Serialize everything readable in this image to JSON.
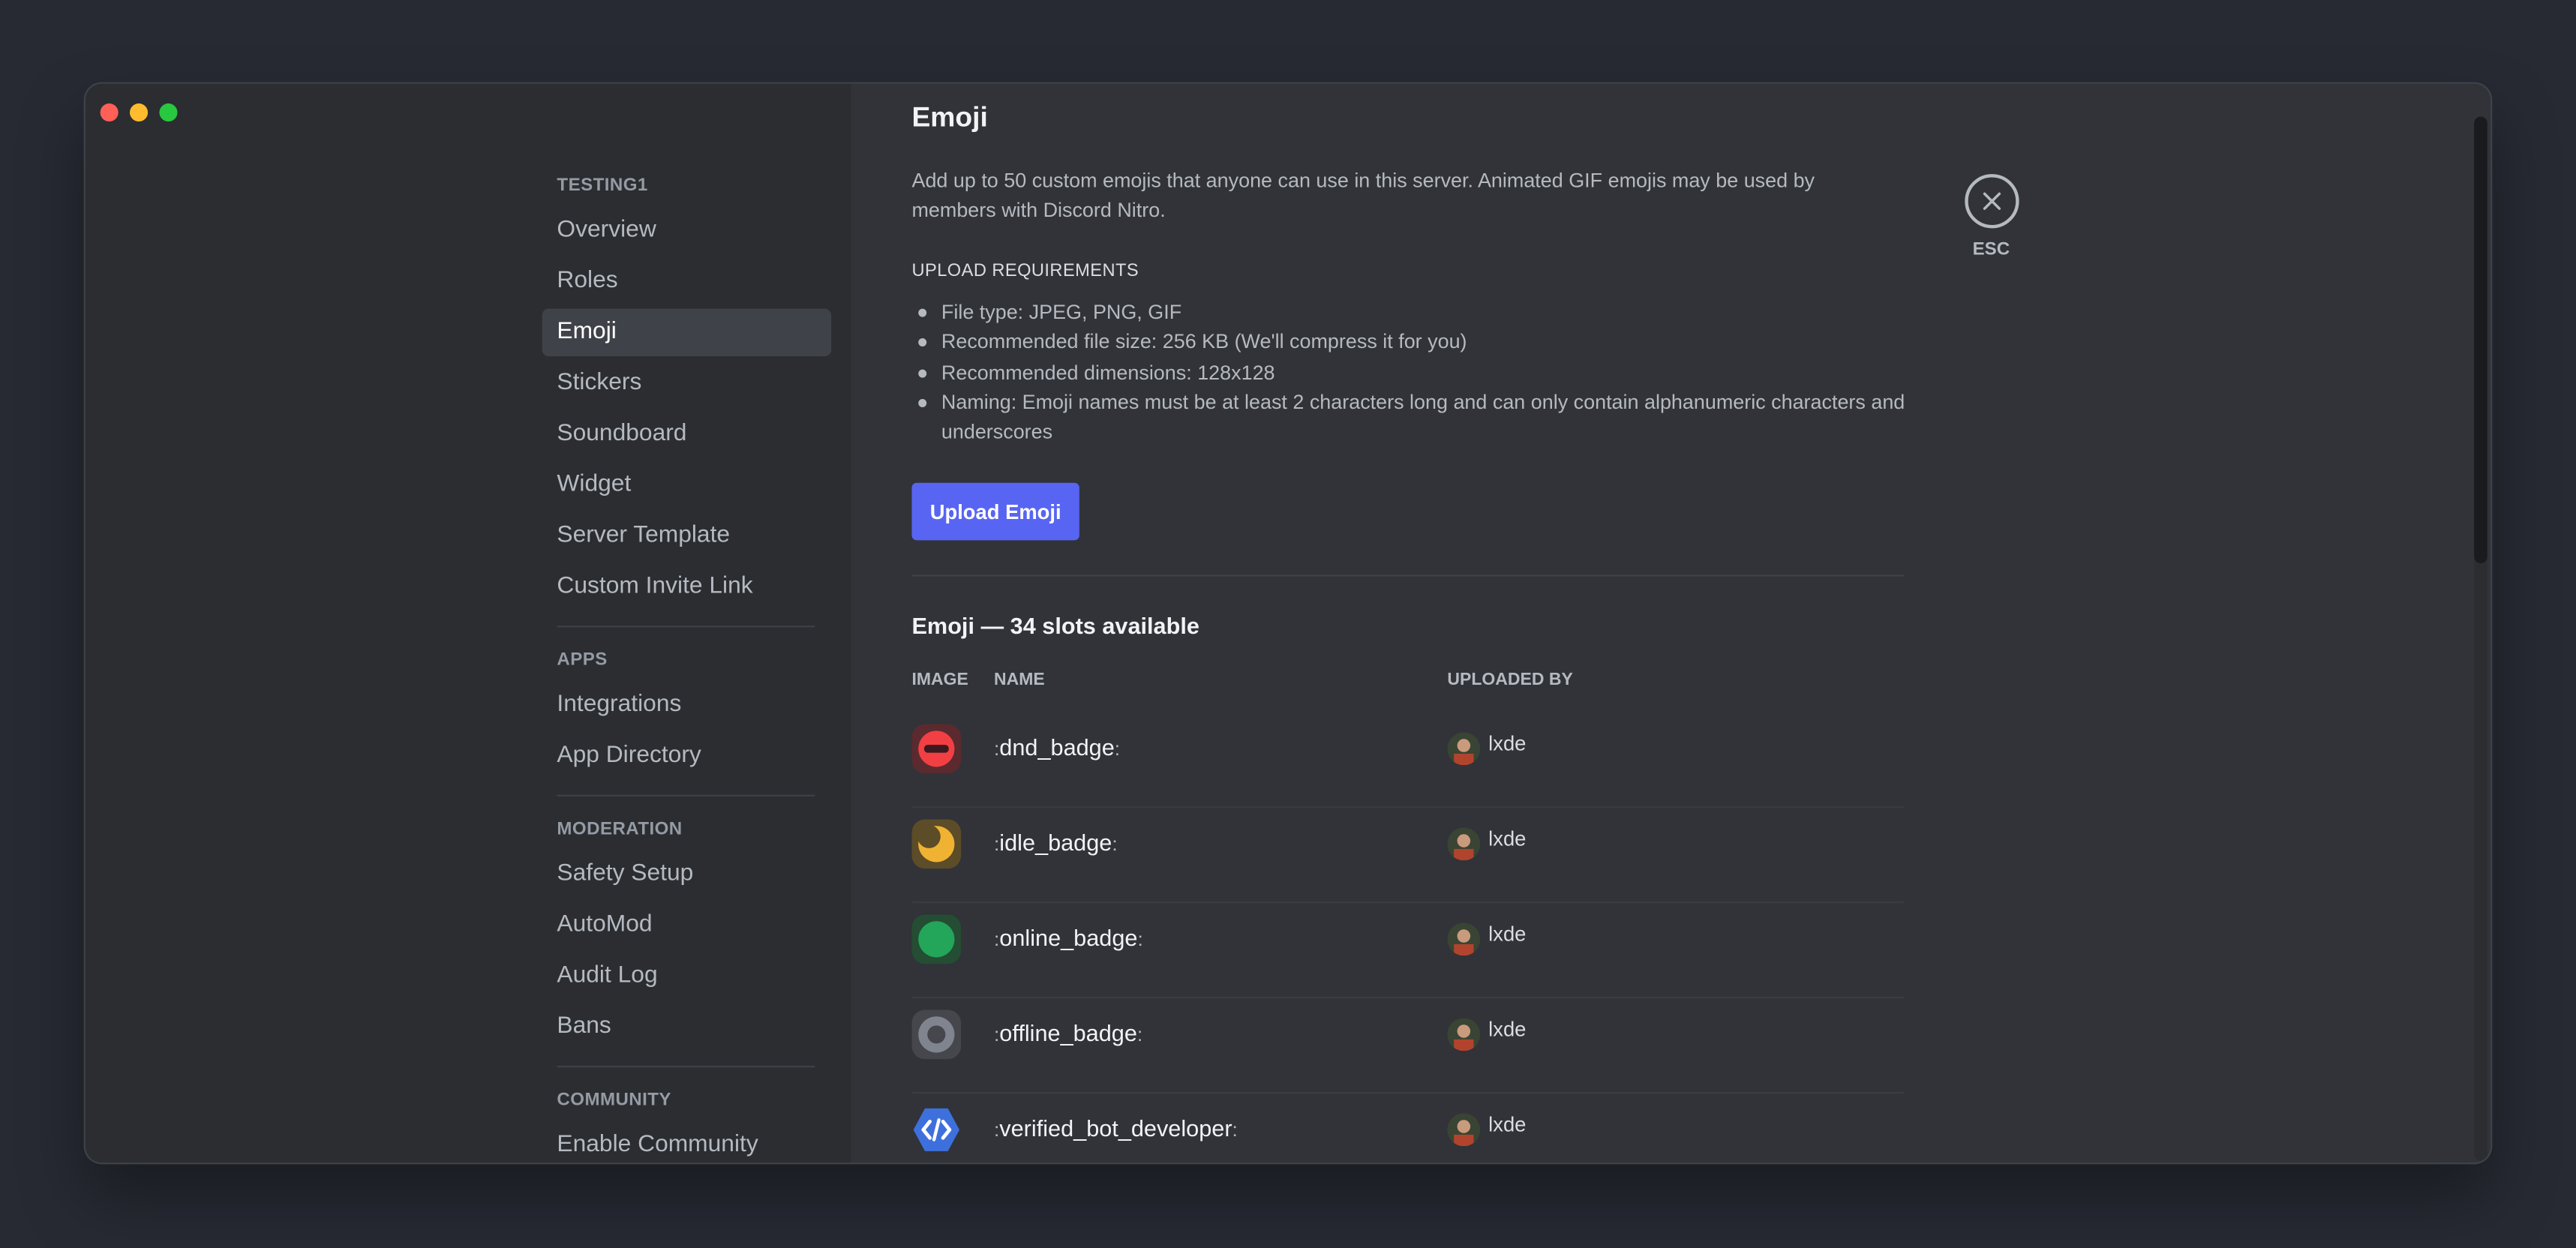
{
  "sidebar": {
    "server_header": "TESTING1",
    "server_items": [
      "Overview",
      "Roles",
      "Emoji",
      "Stickers",
      "Soundboard",
      "Widget",
      "Server Template",
      "Custom Invite Link"
    ],
    "selected": "Emoji",
    "apps_header": "APPS",
    "apps_items": [
      "Integrations",
      "App Directory"
    ],
    "moderation_header": "MODERATION",
    "moderation_items": [
      "Safety Setup",
      "AutoMod",
      "Audit Log",
      "Bans"
    ],
    "community_header": "COMMUNITY",
    "community_items": [
      "Enable Community"
    ]
  },
  "main": {
    "title": "Emoji",
    "intro": "Add up to 50 custom emojis that anyone can use in this server. Animated GIF emojis may be used by members with Discord Nitro.",
    "requirements_title": "UPLOAD REQUIREMENTS",
    "requirements": [
      "File type: JPEG, PNG, GIF",
      "Recommended file size: 256 KB (We'll compress it for you)",
      "Recommended dimensions: 128x128",
      "Naming: Emoji names must be at least 2 characters long and can only contain alphanumeric characters and underscores"
    ],
    "upload_button": "Upload Emoji",
    "slots_title": "Emoji — 34 slots available",
    "columns": {
      "image": "IMAGE",
      "name": "NAME",
      "uploaded_by": "UPLOADED BY"
    },
    "emojis": [
      {
        "name": "dnd_badge",
        "icon": "dnd-badge-icon",
        "uploader": "lxde"
      },
      {
        "name": "idle_badge",
        "icon": "idle-badge-icon",
        "uploader": "lxde"
      },
      {
        "name": "online_badge",
        "icon": "online-badge-icon",
        "uploader": "lxde"
      },
      {
        "name": "offline_badge",
        "icon": "offline-badge-icon",
        "uploader": "lxde"
      },
      {
        "name": "verified_bot_developer",
        "icon": "verified-bot-developer-icon",
        "uploader": "lxde"
      }
    ]
  },
  "close": {
    "label": "ESC"
  },
  "colors": {
    "accent": "#5865f2",
    "dnd": "#f23f43",
    "idle": "#f0b232",
    "online": "#23a55a",
    "offline": "#80848e",
    "dev_badge": "#3e70dd"
  }
}
